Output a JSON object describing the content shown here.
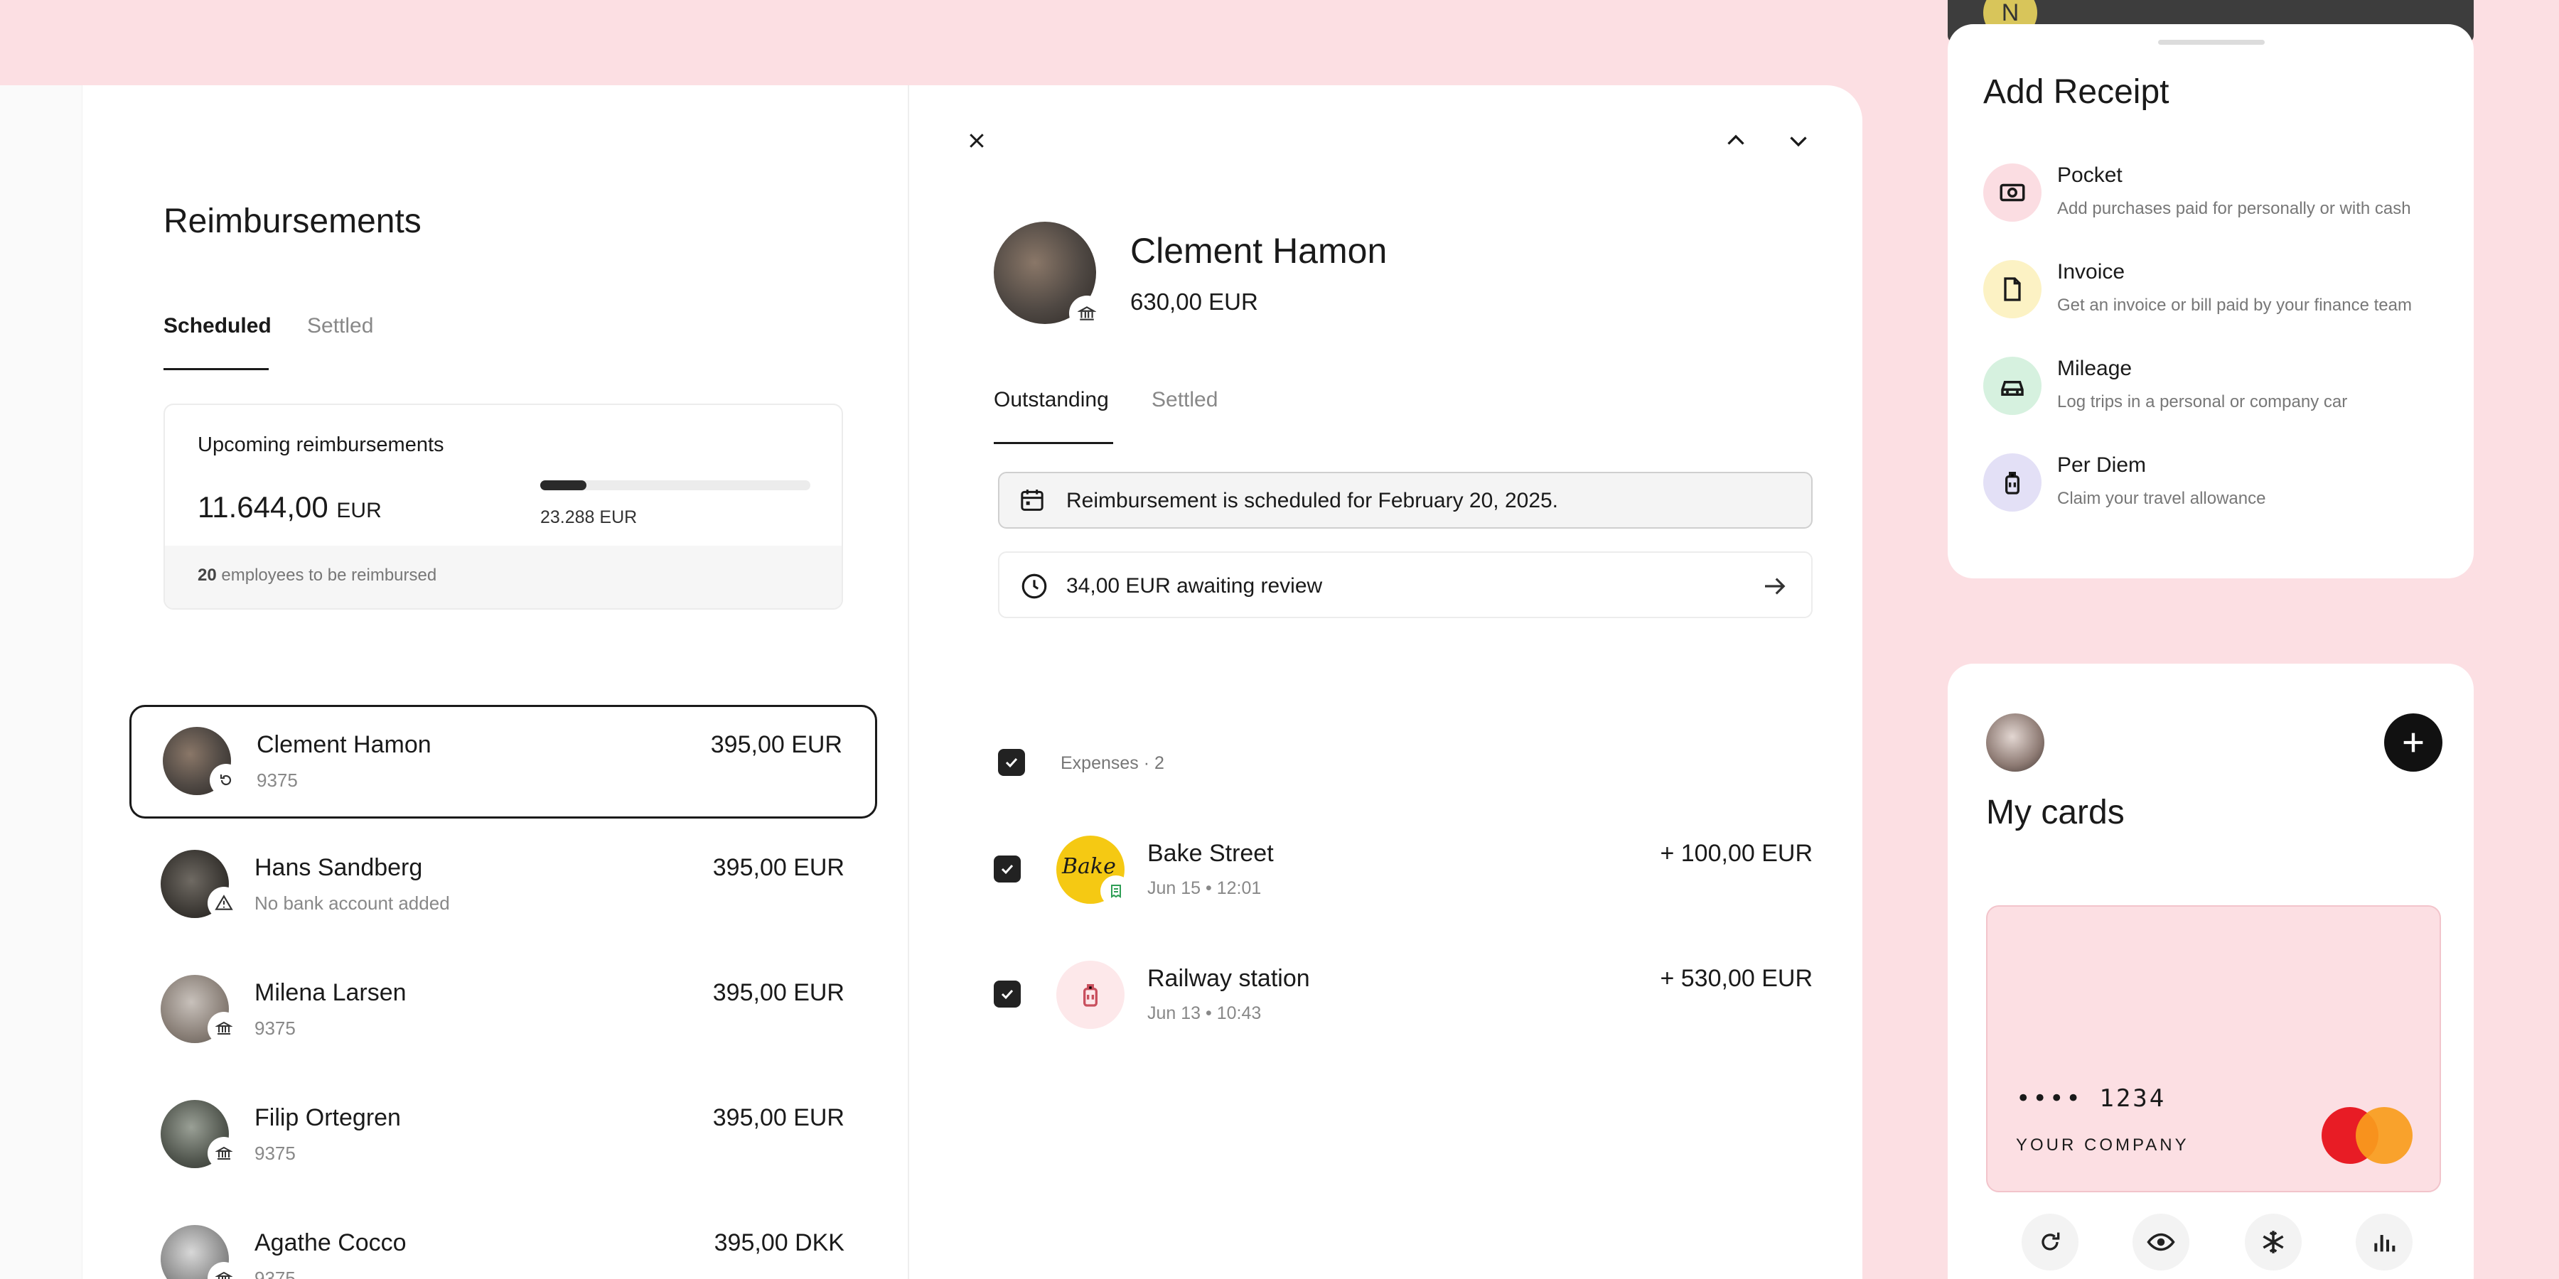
{
  "reimbursements": {
    "title": "Reimbursements",
    "tabs": [
      "Scheduled",
      "Settled"
    ],
    "summary": {
      "title": "Upcoming reimbursements",
      "amount": "11.644,00",
      "currency": "EUR",
      "progress_label": "23.288 EUR",
      "progress_fraction": 0.17,
      "employees_count": "20",
      "employees_text": "employees to be reimbursed"
    },
    "rows": [
      {
        "name": "Clement Hamon",
        "sub": "9375",
        "amount": "395,00 EUR",
        "badge_icon": "retry-icon"
      },
      {
        "name": "Hans Sandberg",
        "sub": "No bank account added",
        "amount": "395,00 EUR",
        "badge_icon": "warning-icon"
      },
      {
        "name": "Milena Larsen",
        "sub": "9375",
        "amount": "395,00 EUR",
        "badge_icon": "bank-icon"
      },
      {
        "name": "Filip Ortegren",
        "sub": "9375",
        "amount": "395,00 EUR",
        "badge_icon": "bank-icon"
      },
      {
        "name": "Agathe Cocco",
        "sub": "9375",
        "amount": "395,00 DKK",
        "badge_icon": "bank-icon"
      }
    ]
  },
  "detail": {
    "name": "Clement Hamon",
    "total": "630,00 EUR",
    "tabs": [
      "Outstanding",
      "Settled"
    ],
    "scheduled_banner": "Reimbursement is scheduled for February 20, 2025.",
    "awaiting": "34,00 EUR awaiting review",
    "expenses_label": "Expenses · 2",
    "expenses": [
      {
        "merchant": "Bake Street",
        "datetime": "Jun 15 • 12:01",
        "amount": "+ 100,00 EUR",
        "logo_text": "Bake"
      },
      {
        "merchant": "Railway station",
        "datetime": "Jun 13 • 10:43",
        "amount": "+ 530,00 EUR"
      }
    ]
  },
  "add_receipt": {
    "title": "Add Receipt",
    "items": [
      {
        "title": "Pocket",
        "desc": "Add purchases paid for personally or with cash",
        "color": "#fbdde2"
      },
      {
        "title": "Invoice",
        "desc": "Get an invoice or bill paid by your finance team",
        "color": "#fcf2c4"
      },
      {
        "title": "Mileage",
        "desc": "Log trips in a personal or company car",
        "color": "#d6f1df"
      },
      {
        "title": "Per Diem",
        "desc": "Claim your travel allowance",
        "color": "#e3e0f6"
      }
    ],
    "peek_letter": "N"
  },
  "my_cards": {
    "title": "My cards",
    "card_number": "•••• 1234",
    "company": "YOUR COMPANY",
    "card_color": "#fcdfe3"
  }
}
